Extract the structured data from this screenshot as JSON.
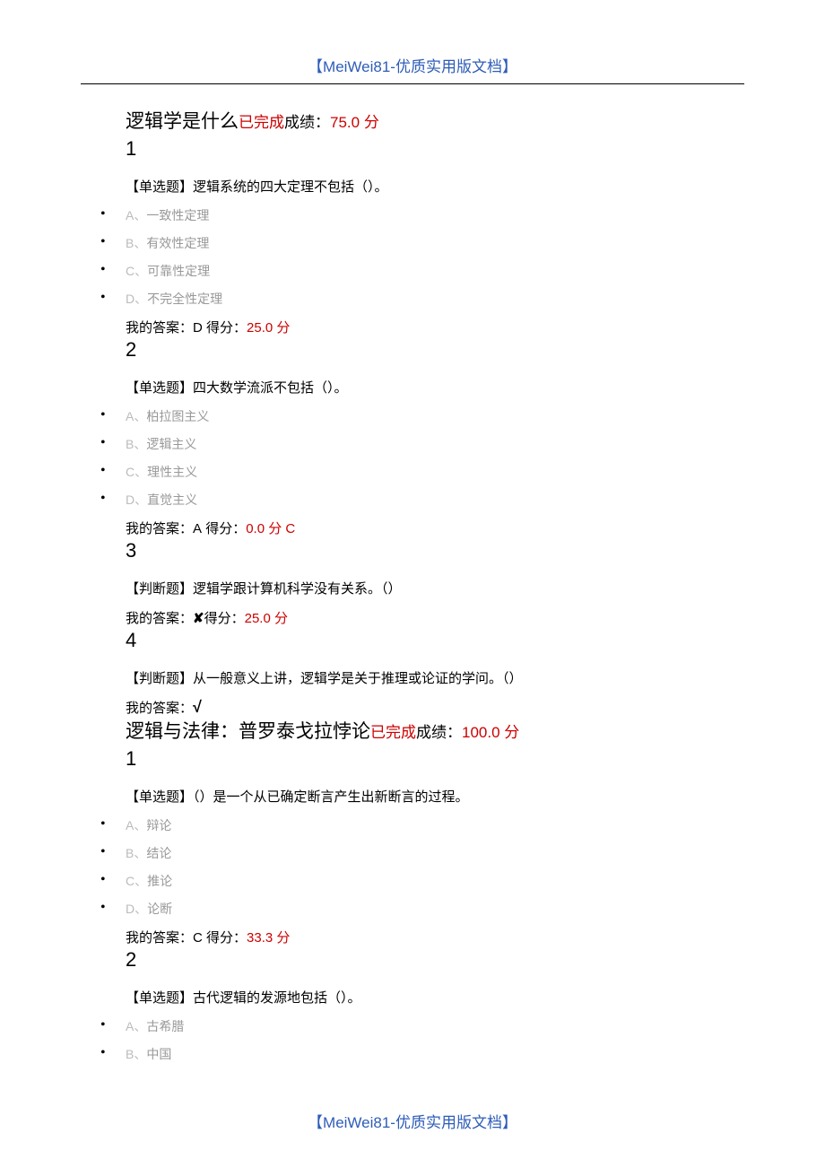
{
  "header": "【MeiWei81-优质实用版文档】",
  "footer": "【MeiWei81-优质实用版文档】",
  "sections": [
    {
      "title": "逻辑学是什么",
      "completed": "已完成",
      "score_label": "成绩：",
      "score_value": "75.0",
      "score_unit": " 分",
      "questions": [
        {
          "number": "1",
          "text": "【单选题】逻辑系统的四大定理不包括（）。",
          "options": [
            {
              "letter": "A、",
              "text": "一致性定理"
            },
            {
              "letter": "B、",
              "text": "有效性定理"
            },
            {
              "letter": "C、",
              "text": "可靠性定理"
            },
            {
              "letter": "D、",
              "text": "不完全性定理"
            }
          ],
          "answer_prefix": "我的答案：",
          "answer_letter": "D",
          "answer_score_label": " 得分：",
          "answer_score": "25.0",
          "answer_score_unit": " 分",
          "correct": ""
        },
        {
          "number": "2",
          "text": "【单选题】四大数学流派不包括（）。",
          "options": [
            {
              "letter": "A、",
              "text": "柏拉图主义"
            },
            {
              "letter": "B、",
              "text": "逻辑主义"
            },
            {
              "letter": "C、",
              "text": "理性主义"
            },
            {
              "letter": "D、",
              "text": "直觉主义"
            }
          ],
          "answer_prefix": "我的答案：",
          "answer_letter": "A",
          "answer_score_label": " 得分：",
          "answer_score": "0.0",
          "answer_score_unit": " 分 ",
          "correct": "C"
        },
        {
          "number": "3",
          "text": "【判断题】逻辑学跟计算机科学没有关系。（）",
          "options": [],
          "answer_prefix": "我的答案：",
          "answer_symbol": "✘",
          "answer_score_label": "得分：",
          "answer_score": "25.0",
          "answer_score_unit": " 分",
          "correct": ""
        },
        {
          "number": "4",
          "text": "【判断题】从一般意义上讲，逻辑学是关于推理或论证的学问。（）",
          "options": [],
          "answer_prefix": "我的答案：",
          "answer_symbol": "√",
          "answer_score_label": "",
          "answer_score": "",
          "answer_score_unit": "",
          "correct": ""
        }
      ]
    },
    {
      "title": "逻辑与法律：普罗泰戈拉悖论",
      "completed": "已完成",
      "score_label": "成绩：",
      "score_value": "100.0",
      "score_unit": " 分",
      "questions": [
        {
          "number": "1",
          "text": "【单选题】（）是一个从已确定断言产生出新断言的过程。",
          "options": [
            {
              "letter": "A、",
              "text": "辩论"
            },
            {
              "letter": "B、",
              "text": "结论"
            },
            {
              "letter": "C、",
              "text": "推论"
            },
            {
              "letter": "D、",
              "text": "论断"
            }
          ],
          "answer_prefix": "我的答案：",
          "answer_letter": "C",
          "answer_score_label": " 得分：",
          "answer_score": "33.3",
          "answer_score_unit": " 分",
          "correct": ""
        },
        {
          "number": "2",
          "text": "【单选题】古代逻辑的发源地包括（）。",
          "options": [
            {
              "letter": "A、",
              "text": "古希腊"
            },
            {
              "letter": "B、",
              "text": "中国"
            }
          ],
          "answer_prefix": "",
          "answer_letter": "",
          "answer_score_label": "",
          "answer_score": "",
          "answer_score_unit": "",
          "correct": ""
        }
      ]
    }
  ]
}
